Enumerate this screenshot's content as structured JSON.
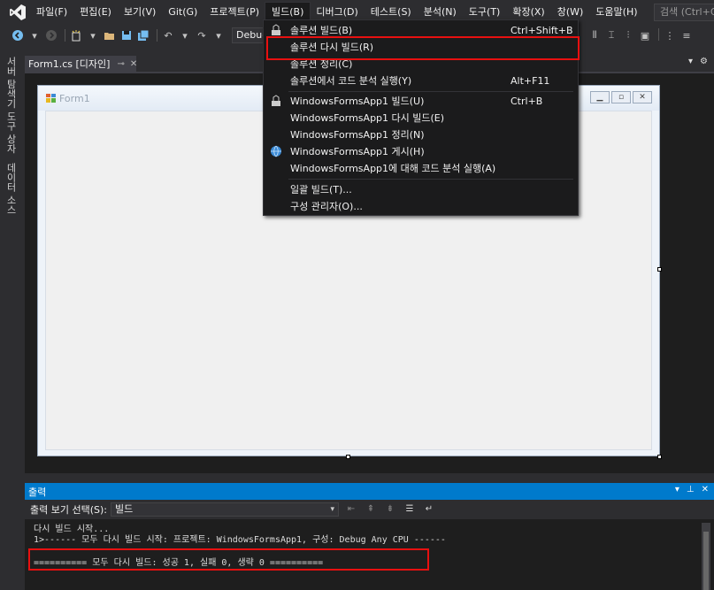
{
  "menubar": {
    "items": [
      "파일(F)",
      "편집(E)",
      "보기(V)",
      "Git(G)",
      "프로젝트(P)",
      "빌드(B)",
      "디버그(D)",
      "테스트(S)",
      "분석(N)",
      "도구(T)",
      "확장(X)",
      "창(W)",
      "도움말(H)"
    ],
    "active": "빌드(B)",
    "search_placeholder": "검색 (Ctrl+Q)"
  },
  "toolbar": {
    "config": "Debug"
  },
  "side_tabs": [
    "서버 탐색기",
    "도구 상자",
    "데이터 소스"
  ],
  "document_tab": {
    "label": "Form1.cs [디자인]"
  },
  "form": {
    "title": "Form1"
  },
  "build_menu": {
    "items": [
      {
        "label": "솔루션 빌드(B)",
        "shortcut": "Ctrl+Shift+B",
        "icon": "build-icon"
      },
      {
        "label": "솔루션 다시 빌드(R)",
        "shortcut": "",
        "icon": ""
      },
      {
        "label": "솔루션 정리(C)",
        "shortcut": "",
        "icon": ""
      },
      {
        "label": "솔루션에서 코드 분석 실행(Y)",
        "shortcut": "Alt+F11",
        "icon": ""
      },
      {
        "label": "WindowsFormsApp1 빌드(U)",
        "shortcut": "Ctrl+B",
        "icon": "build-icon"
      },
      {
        "label": "WindowsFormsApp1 다시 빌드(E)",
        "shortcut": "",
        "icon": ""
      },
      {
        "label": "WindowsFormsApp1 정리(N)",
        "shortcut": "",
        "icon": ""
      },
      {
        "label": "WindowsFormsApp1 게시(H)",
        "shortcut": "",
        "icon": "globe-icon"
      },
      {
        "label": "WindowsFormsApp1에 대해 코드 분석 실행(A)",
        "shortcut": "",
        "icon": ""
      },
      {
        "label": "일괄 빌드(T)...",
        "shortcut": "",
        "icon": ""
      },
      {
        "label": "구성 관리자(O)...",
        "shortcut": "",
        "icon": ""
      }
    ],
    "highlighted": "솔루션 다시 빌드(R)"
  },
  "output": {
    "title": "출력",
    "source_label": "출력 보기 선택(S):",
    "source_value": "빌드",
    "lines": [
      "다시 빌드 시작...",
      "1>------ 모두 다시 빌드 시작: 프로젝트: WindowsFormsApp1, 구성: Debug Any CPU ------",
      "========== 모두 다시 빌드: 성공 1, 실패 0, 생략 0 =========="
    ]
  },
  "colors": {
    "accent": "#007acc",
    "highlight": "#e81010"
  }
}
